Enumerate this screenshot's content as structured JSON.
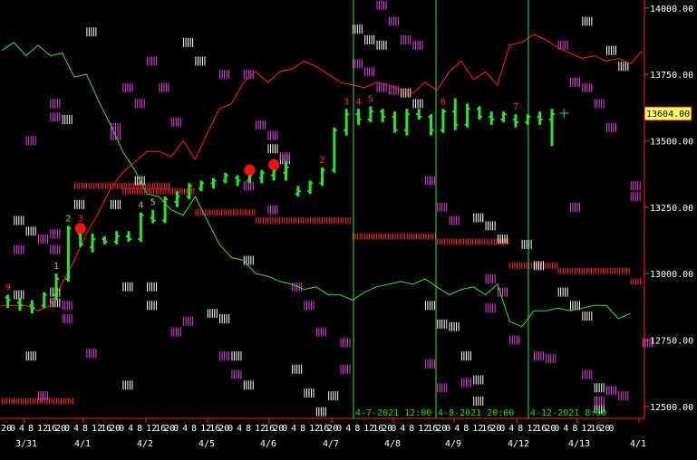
{
  "chart_data": {
    "type": "candlestick",
    "y_ticks": [
      12500.0,
      12750.0,
      13000.0,
      13250.0,
      13500.0,
      13750.0,
      14000.0
    ],
    "y_range": [
      12455,
      14030
    ],
    "last_price": 13604.0,
    "last_price_label": "13604.00",
    "x_hour_labels": [
      "20",
      "0",
      "4",
      "8",
      "12",
      "16",
      "20",
      "0",
      "4",
      "8",
      "12",
      "16",
      "20",
      "0",
      "4",
      "8",
      "12",
      "16",
      "20",
      "0",
      "4",
      "8",
      "12",
      "16",
      "20",
      "0",
      "4",
      "8",
      "12",
      "16",
      "20",
      "0",
      "4",
      "8",
      "12",
      "16",
      "20",
      "0",
      "4",
      "8",
      "12",
      "16",
      "20",
      "0",
      "4",
      "8",
      "12",
      "16",
      "20",
      "0",
      "4",
      "8",
      "12",
      "16",
      "20",
      "0",
      "4",
      "8",
      "12",
      "16",
      "20",
      "0",
      "4",
      "8",
      "12",
      "16",
      "20",
      "0"
    ],
    "x_date_labels": [
      "3/31",
      "4/1",
      "4/2",
      "4/5",
      "4/6",
      "4/7",
      "4/8",
      "4/9",
      "4/12",
      "4/13",
      "4/1"
    ],
    "vertical_markers": [
      {
        "label": "4-7-2021 12:00"
      },
      {
        "label": "4-8-2021 20:00"
      },
      {
        "label": "4-12-2021 8:00"
      }
    ],
    "bars": [
      {
        "o": 12910,
        "h": 12920,
        "l": 12870,
        "c": 12900
      },
      {
        "o": 12890,
        "h": 12910,
        "l": 12860,
        "c": 12880
      },
      {
        "o": 12880,
        "h": 12900,
        "l": 12850,
        "c": 12870
      },
      {
        "o": 12880,
        "h": 12930,
        "l": 12870,
        "c": 12920
      },
      {
        "o": 12920,
        "h": 13000,
        "l": 12900,
        "c": 12980
      },
      {
        "o": 12980,
        "h": 13180,
        "l": 12970,
        "c": 13170
      },
      {
        "o": 13150,
        "h": 13180,
        "l": 13100,
        "c": 13110
      },
      {
        "o": 13100,
        "h": 13150,
        "l": 13080,
        "c": 13130
      },
      {
        "o": 13130,
        "h": 13140,
        "l": 13110,
        "c": 13120
      },
      {
        "o": 13120,
        "h": 13160,
        "l": 13110,
        "c": 13140
      },
      {
        "o": 13140,
        "h": 13160,
        "l": 13120,
        "c": 13130
      },
      {
        "o": 13130,
        "h": 13230,
        "l": 13120,
        "c": 13220
      },
      {
        "o": 13210,
        "h": 13240,
        "l": 13190,
        "c": 13200
      },
      {
        "o": 13200,
        "h": 13290,
        "l": 13190,
        "c": 13280
      },
      {
        "o": 13270,
        "h": 13310,
        "l": 13250,
        "c": 13290
      },
      {
        "o": 13290,
        "h": 13340,
        "l": 13280,
        "c": 13330
      },
      {
        "o": 13320,
        "h": 13350,
        "l": 13310,
        "c": 13340
      },
      {
        "o": 13340,
        "h": 13360,
        "l": 13320,
        "c": 13350
      },
      {
        "o": 13350,
        "h": 13380,
        "l": 13340,
        "c": 13370
      },
      {
        "o": 13360,
        "h": 13370,
        "l": 13330,
        "c": 13350
      },
      {
        "o": 13350,
        "h": 13380,
        "l": 13340,
        "c": 13370
      },
      {
        "o": 13360,
        "h": 13390,
        "l": 13340,
        "c": 13380
      },
      {
        "o": 13370,
        "h": 13400,
        "l": 13350,
        "c": 13390
      },
      {
        "o": 13380,
        "h": 13420,
        "l": 13350,
        "c": 13400
      },
      {
        "o": 13300,
        "h": 13330,
        "l": 13290,
        "c": 13310
      },
      {
        "o": 13310,
        "h": 13350,
        "l": 13300,
        "c": 13340
      },
      {
        "o": 13340,
        "h": 13400,
        "l": 13330,
        "c": 13390
      },
      {
        "o": 13390,
        "h": 13550,
        "l": 13380,
        "c": 13540
      },
      {
        "o": 13540,
        "h": 13620,
        "l": 13520,
        "c": 13600
      },
      {
        "o": 13600,
        "h": 13620,
        "l": 13560,
        "c": 13580
      },
      {
        "o": 13580,
        "h": 13630,
        "l": 13570,
        "c": 13610
      },
      {
        "o": 13610,
        "h": 13620,
        "l": 13570,
        "c": 13590
      },
      {
        "o": 13590,
        "h": 13610,
        "l": 13530,
        "c": 13540
      },
      {
        "o": 13540,
        "h": 13620,
        "l": 13520,
        "c": 13600
      },
      {
        "o": 13600,
        "h": 13620,
        "l": 13580,
        "c": 13590
      },
      {
        "o": 13590,
        "h": 13600,
        "l": 13520,
        "c": 13540
      },
      {
        "o": 13540,
        "h": 13620,
        "l": 13530,
        "c": 13610
      },
      {
        "o": 13610,
        "h": 13660,
        "l": 13540,
        "c": 13560
      },
      {
        "o": 13560,
        "h": 13640,
        "l": 13550,
        "c": 13620
      },
      {
        "o": 13620,
        "h": 13630,
        "l": 13580,
        "c": 13590
      },
      {
        "o": 13590,
        "h": 13610,
        "l": 13560,
        "c": 13580
      },
      {
        "o": 13580,
        "h": 13610,
        "l": 13570,
        "c": 13600
      },
      {
        "o": 13580,
        "h": 13600,
        "l": 13550,
        "c": 13570
      },
      {
        "o": 13570,
        "h": 13600,
        "l": 13560,
        "c": 13590
      },
      {
        "o": 13590,
        "h": 13610,
        "l": 13560,
        "c": 13580
      },
      {
        "o": 13580,
        "h": 13620,
        "l": 13480,
        "c": 13600
      }
    ],
    "count_labels": [
      {
        "bar": 0,
        "text": "9",
        "color": "#ff3030",
        "above": true
      },
      {
        "bar": 4,
        "text": "1",
        "color": "#c8c800",
        "above": true
      },
      {
        "bar": 5,
        "text": "2",
        "color": "#c8c800",
        "above": true
      },
      {
        "bar": 6,
        "text": "3",
        "color": "#ff3030",
        "above": true
      },
      {
        "bar": 11,
        "text": "4",
        "color": "#c8c800",
        "above": true
      },
      {
        "bar": 12,
        "text": "5",
        "color": "#c8c800",
        "above": true
      },
      {
        "bar": 26,
        "text": "2",
        "color": "#ff3030",
        "above": true
      },
      {
        "bar": 28,
        "text": "3",
        "color": "#ff3030",
        "above": true
      },
      {
        "bar": 29,
        "text": "4",
        "color": "#ff3030",
        "above": true
      },
      {
        "bar": 30,
        "text": "5",
        "color": "#ff3030",
        "above": true
      },
      {
        "bar": 36,
        "text": "6",
        "color": "#ff3030",
        "above": true
      },
      {
        "bar": 42,
        "text": "7",
        "color": "#ff3030",
        "above": true
      }
    ],
    "red_dots": [
      {
        "bar": 6,
        "price": 13170
      },
      {
        "bar": 20,
        "price": 13390
      },
      {
        "bar": 22,
        "price": 13410
      }
    ],
    "red_line": [
      [
        0,
        12880
      ],
      [
        4,
        12880
      ],
      [
        6,
        12860
      ],
      [
        8,
        12880
      ],
      [
        12,
        13050
      ],
      [
        14,
        13150
      ],
      [
        16,
        13230
      ],
      [
        18,
        13320
      ],
      [
        20,
        13380
      ],
      [
        22,
        13420
      ],
      [
        24,
        13460
      ],
      [
        26,
        13460
      ],
      [
        28,
        13440
      ],
      [
        30,
        13500
      ],
      [
        32,
        13430
      ],
      [
        34,
        13530
      ],
      [
        36,
        13620
      ],
      [
        38,
        13640
      ],
      [
        40,
        13720
      ],
      [
        42,
        13760
      ],
      [
        44,
        13720
      ],
      [
        46,
        13760
      ],
      [
        48,
        13770
      ],
      [
        50,
        13800
      ],
      [
        52,
        13780
      ],
      [
        54,
        13750
      ],
      [
        56,
        13720
      ],
      [
        58,
        13710
      ],
      [
        60,
        13700
      ],
      [
        62,
        13720
      ],
      [
        64,
        13710
      ],
      [
        66,
        13690
      ],
      [
        68,
        13680
      ],
      [
        70,
        13720
      ],
      [
        72,
        13690
      ],
      [
        74,
        13760
      ],
      [
        76,
        13800
      ],
      [
        78,
        13730
      ],
      [
        80,
        13760
      ],
      [
        82,
        13710
      ],
      [
        84,
        13860
      ],
      [
        86,
        13870
      ],
      [
        88,
        13900
      ],
      [
        90,
        13880
      ],
      [
        92,
        13850
      ],
      [
        94,
        13830
      ],
      [
        96,
        13810
      ],
      [
        98,
        13820
      ],
      [
        100,
        13800
      ],
      [
        102,
        13810
      ],
      [
        104,
        13790
      ],
      [
        106,
        13840
      ]
    ],
    "green_line": [
      [
        0,
        13840
      ],
      [
        2,
        13870
      ],
      [
        4,
        13820
      ],
      [
        6,
        13860
      ],
      [
        8,
        13820
      ],
      [
        10,
        13830
      ],
      [
        12,
        13740
      ],
      [
        14,
        13750
      ],
      [
        16,
        13650
      ],
      [
        18,
        13560
      ],
      [
        20,
        13460
      ],
      [
        22,
        13390
      ],
      [
        24,
        13300
      ],
      [
        26,
        13290
      ],
      [
        28,
        13240
      ],
      [
        30,
        13220
      ],
      [
        32,
        13290
      ],
      [
        34,
        13200
      ],
      [
        36,
        13110
      ],
      [
        38,
        13060
      ],
      [
        40,
        13050
      ],
      [
        42,
        13000
      ],
      [
        44,
        12990
      ],
      [
        46,
        12970
      ],
      [
        48,
        12960
      ],
      [
        50,
        12940
      ],
      [
        52,
        12950
      ],
      [
        54,
        12920
      ],
      [
        56,
        12920
      ],
      [
        58,
        12900
      ],
      [
        60,
        12930
      ],
      [
        62,
        12950
      ],
      [
        64,
        12960
      ],
      [
        66,
        12970
      ],
      [
        68,
        12960
      ],
      [
        70,
        12980
      ],
      [
        72,
        12950
      ],
      [
        74,
        12920
      ],
      [
        76,
        12940
      ],
      [
        78,
        12950
      ],
      [
        80,
        12920
      ],
      [
        82,
        12960
      ],
      [
        84,
        12820
      ],
      [
        86,
        12800
      ],
      [
        88,
        12860
      ],
      [
        90,
        12860
      ],
      [
        92,
        12870
      ],
      [
        94,
        12860
      ],
      [
        96,
        12870
      ],
      [
        98,
        12880
      ],
      [
        100,
        12880
      ],
      [
        102,
        12830
      ],
      [
        104,
        12850
      ]
    ],
    "support_lines": [
      {
        "x1": 0,
        "x2": 12,
        "price": 12520
      },
      {
        "x1": 12,
        "x2": 28,
        "price": 13330
      },
      {
        "x1": 20,
        "x2": 32,
        "price": 13310
      },
      {
        "x1": 32,
        "x2": 42,
        "price": 13230
      },
      {
        "x1": 42,
        "x2": 58,
        "price": 13200
      },
      {
        "x1": 58,
        "x2": 72,
        "price": 13140
      },
      {
        "x1": 72,
        "x2": 84,
        "price": 13120
      },
      {
        "x1": 84,
        "x2": 92,
        "price": 13030
      },
      {
        "x1": 92,
        "x2": 104,
        "price": 13010
      },
      {
        "x1": 104,
        "x2": 106,
        "price": 12970
      }
    ],
    "price_blocks_magenta": [
      [
        8,
        13640
      ],
      [
        8,
        13590
      ],
      [
        4,
        13500
      ],
      [
        6,
        13130
      ],
      [
        8,
        13150
      ],
      [
        8,
        13090
      ],
      [
        2,
        13090
      ],
      [
        6,
        12540
      ],
      [
        10,
        12880
      ],
      [
        10,
        12830
      ],
      [
        14,
        12700
      ],
      [
        18,
        13550
      ],
      [
        18,
        13520
      ],
      [
        20,
        13700
      ],
      [
        22,
        13640
      ],
      [
        24,
        13800
      ],
      [
        26,
        13700
      ],
      [
        28,
        13570
      ],
      [
        30,
        12820
      ],
      [
        28,
        12780
      ],
      [
        36,
        12690
      ],
      [
        38,
        12620
      ],
      [
        36,
        13750
      ],
      [
        40,
        13750
      ],
      [
        42,
        13560
      ],
      [
        44,
        13520
      ],
      [
        46,
        13440
      ],
      [
        40,
        13330
      ],
      [
        44,
        13240
      ],
      [
        48,
        12950
      ],
      [
        50,
        12880
      ],
      [
        52,
        12780
      ],
      [
        56,
        12740
      ],
      [
        56,
        12640
      ],
      [
        58,
        13790
      ],
      [
        60,
        13760
      ],
      [
        62,
        13700
      ],
      [
        64,
        13690
      ],
      [
        62,
        14010
      ],
      [
        64,
        13950
      ],
      [
        66,
        13880
      ],
      [
        68,
        13860
      ],
      [
        70,
        13350
      ],
      [
        72,
        13250
      ],
      [
        74,
        13200
      ],
      [
        76,
        12590
      ],
      [
        72,
        12570
      ],
      [
        70,
        12660
      ],
      [
        80,
        12980
      ],
      [
        82,
        12930
      ],
      [
        80,
        12870
      ],
      [
        84,
        12750
      ],
      [
        88,
        12690
      ],
      [
        90,
        12680
      ],
      [
        92,
        13860
      ],
      [
        94,
        13720
      ],
      [
        96,
        13700
      ],
      [
        98,
        13640
      ],
      [
        100,
        13550
      ],
      [
        102,
        12540
      ],
      [
        98,
        12520
      ],
      [
        100,
        12560
      ],
      [
        96,
        12620
      ],
      [
        94,
        13250
      ],
      [
        104,
        13330
      ],
      [
        104,
        13290
      ],
      [
        106,
        12740
      ]
    ],
    "price_blocks_white": [
      [
        2,
        13200
      ],
      [
        4,
        13160
      ],
      [
        2,
        12920
      ],
      [
        4,
        12690
      ],
      [
        8,
        12930
      ],
      [
        8,
        12890
      ],
      [
        10,
        13580
      ],
      [
        12,
        13260
      ],
      [
        14,
        13910
      ],
      [
        18,
        13260
      ],
      [
        20,
        12950
      ],
      [
        20,
        12580
      ],
      [
        22,
        13350
      ],
      [
        24,
        12950
      ],
      [
        24,
        12880
      ],
      [
        30,
        13870
      ],
      [
        32,
        13800
      ],
      [
        34,
        12850
      ],
      [
        36,
        12830
      ],
      [
        38,
        12690
      ],
      [
        40,
        12580
      ],
      [
        40,
        13050
      ],
      [
        44,
        13470
      ],
      [
        46,
        13430
      ],
      [
        48,
        12640
      ],
      [
        50,
        12550
      ],
      [
        52,
        12480
      ],
      [
        54,
        12540
      ],
      [
        58,
        13920
      ],
      [
        60,
        13880
      ],
      [
        62,
        13860
      ],
      [
        66,
        13680
      ],
      [
        68,
        13640
      ],
      [
        70,
        12880
      ],
      [
        72,
        12810
      ],
      [
        74,
        12800
      ],
      [
        76,
        12690
      ],
      [
        78,
        12600
      ],
      [
        78,
        12520
      ],
      [
        78,
        13210
      ],
      [
        80,
        13180
      ],
      [
        82,
        13130
      ],
      [
        86,
        13110
      ],
      [
        88,
        13030
      ],
      [
        92,
        12930
      ],
      [
        94,
        12880
      ],
      [
        96,
        12840
      ],
      [
        96,
        13950
      ],
      [
        100,
        13840
      ],
      [
        102,
        13780
      ],
      [
        98,
        12570
      ],
      [
        98,
        12490
      ]
    ]
  }
}
